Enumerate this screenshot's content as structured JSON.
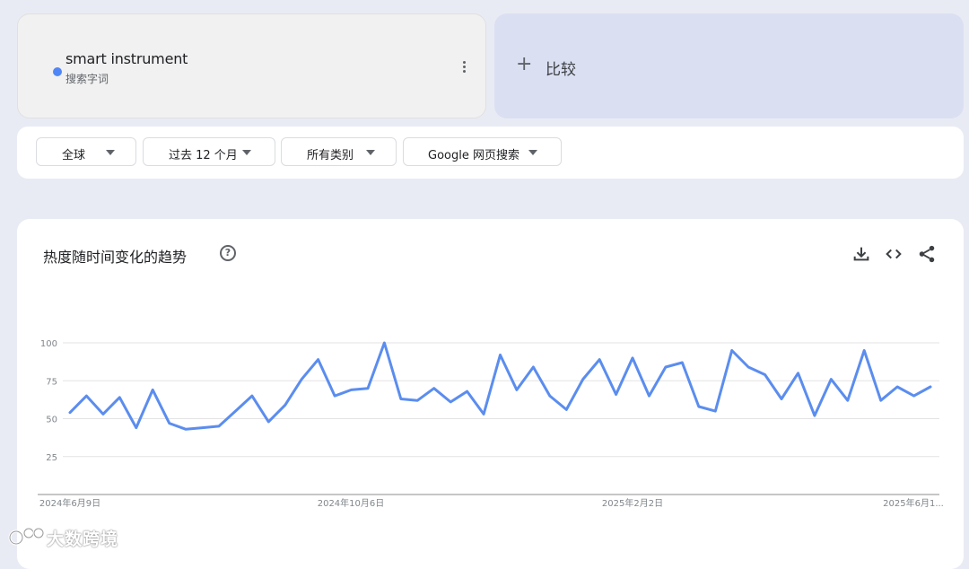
{
  "search_term": {
    "name": "smart instrument",
    "type_label": "搜索字词",
    "dot_color": "#4f86f7"
  },
  "compare": {
    "plus": "+",
    "label": "比较"
  },
  "filters": [
    {
      "label": "全球"
    },
    {
      "label": "过去 12 个月"
    },
    {
      "label": "所有类别"
    },
    {
      "label": "Google 网页搜索"
    }
  ],
  "chart_section": {
    "title": "热度随时间变化的趋势",
    "help": "?",
    "tools": [
      "download-icon",
      "embed-code-icon",
      "share-icon"
    ]
  },
  "chart_data": {
    "type": "line",
    "title": "",
    "xlabel": "",
    "ylabel": "",
    "ylim": [
      0,
      100
    ],
    "yticks": [
      25,
      50,
      75,
      100
    ],
    "x_tick_labels": [
      "2024年6月9日",
      "2024年10月6日",
      "2025年2月2日",
      "2025年6月1..."
    ],
    "x_tick_indices": [
      0,
      17,
      34,
      51
    ],
    "grid": true,
    "series": [
      {
        "color": "#5b8def",
        "values": [
          54,
          65,
          53,
          64,
          44,
          69,
          47,
          43,
          44,
          45,
          55,
          65,
          48,
          59,
          76,
          89,
          65,
          69,
          70,
          100,
          63,
          62,
          70,
          61,
          68,
          53,
          92,
          69,
          84,
          65,
          56,
          76,
          89,
          66,
          90,
          65,
          84,
          87,
          58,
          55,
          95,
          84,
          79,
          63,
          80,
          52,
          76,
          62,
          95,
          62,
          71,
          65,
          71
        ]
      }
    ]
  },
  "watermark": {
    "text": "大数跨境"
  }
}
